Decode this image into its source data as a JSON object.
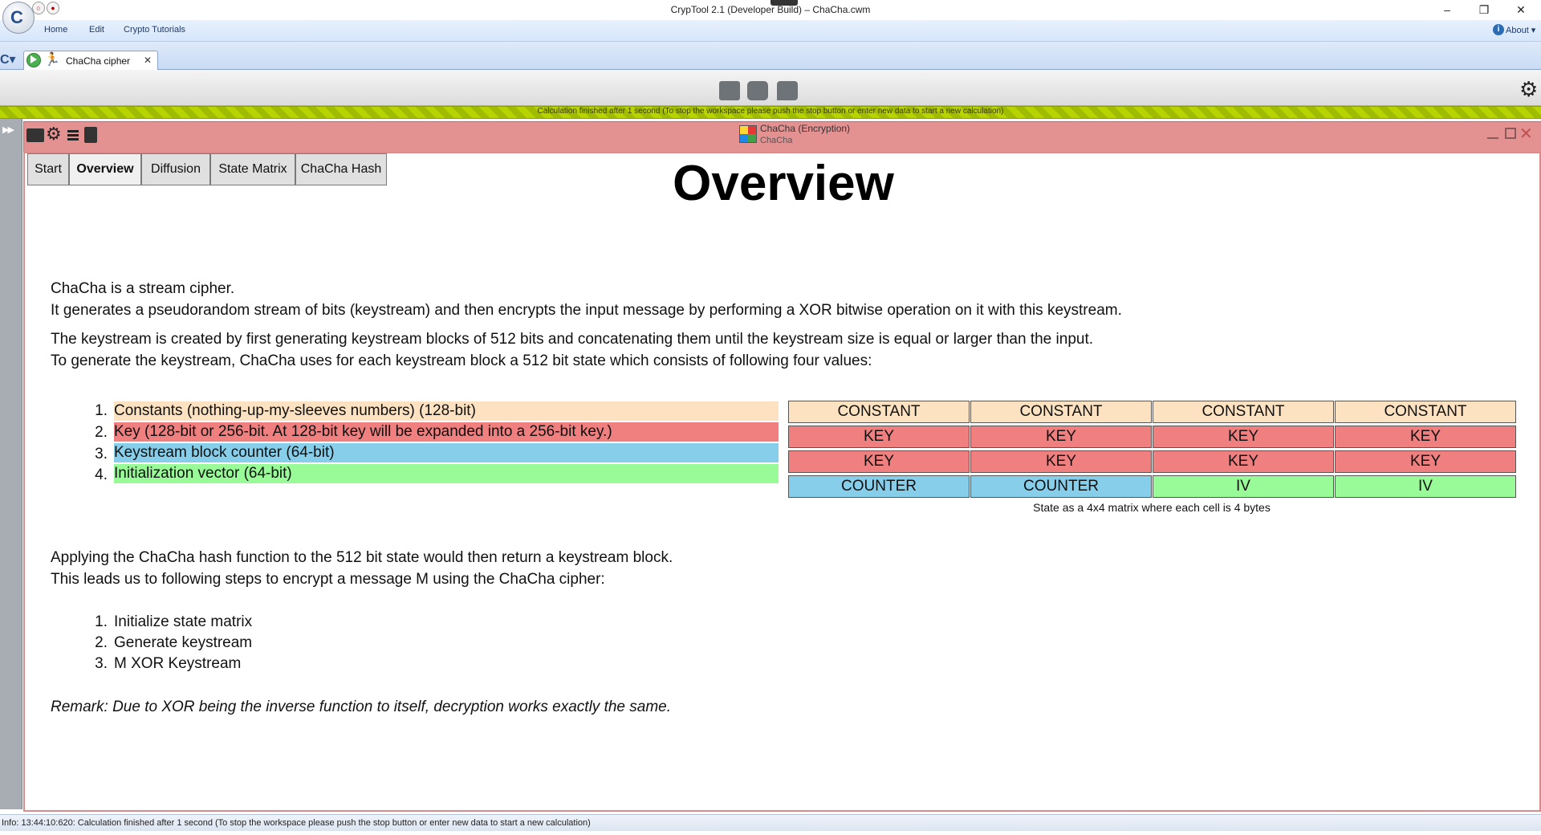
{
  "window": {
    "title": "CrypTool 2.1 (Developer Build) – ChaCha.cwm",
    "minimize": "–",
    "restore": "❐",
    "close": "✕"
  },
  "menu": {
    "items": [
      "Home",
      "Edit",
      "Crypto Tutorials"
    ],
    "about": "About"
  },
  "doc_tab": {
    "label": "ChaCha cipher",
    "close": "✕"
  },
  "status_strip": "Calculation finished after 1 second (To stop the workspace please push the stop button or enter new data to start a new calculation)",
  "component": {
    "title": "ChaCha (Encryption)",
    "subtitle": "ChaCha"
  },
  "nav_tabs": [
    {
      "label": "Start",
      "active": false
    },
    {
      "label": "Overview",
      "active": true
    },
    {
      "label": "Diffusion",
      "active": false
    },
    {
      "label": "State Matrix",
      "active": false
    },
    {
      "label": "ChaCha Hash",
      "active": false
    }
  ],
  "content": {
    "heading": "Overview",
    "intro1": "ChaCha is a stream cipher.",
    "intro2": "It generates a pseudorandom stream of bits (keystream) and then encrypts the input message by performing a XOR bitwise operation on it with this keystream.",
    "intro3": "The keystream is created by first generating keystream blocks of 512 bits and concatenating them until the keystream size is equal or larger than the input.",
    "intro4": "To generate the keystream, ChaCha uses for each keystream block a 512 bit state which consists of following four values:",
    "state_values": [
      {
        "num": "1.",
        "text": "Constants (nothing-up-my-sleeves numbers) (128-bit)",
        "color": "#fde2c2"
      },
      {
        "num": "2.",
        "text": "Key (128-bit or 256-bit. At 128-bit key will be expanded into a 256-bit key.)",
        "color": "#f08080"
      },
      {
        "num": "3.",
        "text": "Keystream block counter (64-bit)",
        "color": "#87ceeb"
      },
      {
        "num": "4.",
        "text": "Initialization vector (64-bit)",
        "color": "#98fb98"
      }
    ],
    "matrix": [
      [
        "CONSTANT",
        "CONSTANT",
        "CONSTANT",
        "CONSTANT"
      ],
      [
        "KEY",
        "KEY",
        "KEY",
        "KEY"
      ],
      [
        "KEY",
        "KEY",
        "KEY",
        "KEY"
      ],
      [
        "COUNTER",
        "COUNTER",
        "IV",
        "IV"
      ]
    ],
    "matrix_caption": "State as a 4x4 matrix where each cell is 4 bytes",
    "apply1": "Applying the ChaCha hash function to the 512 bit state would then return a keystream block.",
    "apply2": "This leads us to following steps to encrypt a message M using the ChaCha cipher:",
    "steps": [
      {
        "num": "1.",
        "text": "Initialize state matrix"
      },
      {
        "num": "2.",
        "text": "Generate keystream"
      },
      {
        "num": "3.",
        "text": "M XOR Keystream"
      }
    ],
    "remark": "Remark: Due to XOR being the inverse function to itself, decryption works exactly the same."
  },
  "bottom_status": "Info: 13:44:10:620: Calculation finished after 1 second (To stop the workspace please push the stop button or enter new data to start a new calculation)",
  "colors": {
    "constant": "#fde2c2",
    "key": "#f08080",
    "counter": "#87ceeb",
    "iv": "#98fb98",
    "component_header": "#e49191",
    "status_strip": "#b8d400"
  }
}
